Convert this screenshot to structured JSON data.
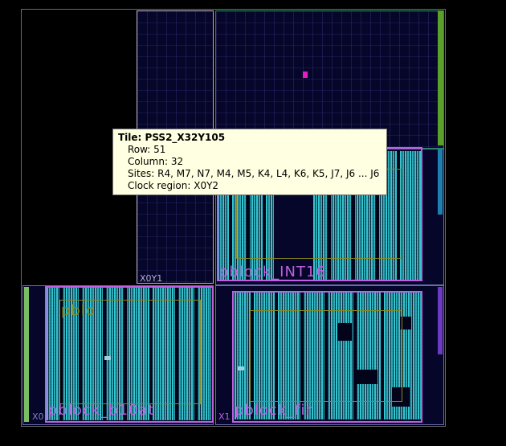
{
  "tooltip": {
    "title": "Tile: PSS2_X32Y105",
    "row": "Row: 51",
    "column": "Column: 32",
    "sites": "Sites: R4, M7, N7, M4, M5, K4, L4, K6, K5, J7, J6 ... J6",
    "clock_region": "Clock region: X0Y2"
  },
  "regions": {
    "x0y1": "X0Y1",
    "x0y0": "X0",
    "x1y0": "X1"
  },
  "pblocks": {
    "int16": "pblock_INT16",
    "fir": "pblock_fir",
    "fir_short": "pblo",
    "bottom_left": "pblock_b10at",
    "bottom_right": "pblock_fir"
  },
  "colors": {
    "pblock_magenta": "#c060e0",
    "pblock_olive": "#8a8a20",
    "logic_cyan": "#38cdd7",
    "clock_region_border": "#9090c0",
    "selected_tile": "#e020c0"
  }
}
